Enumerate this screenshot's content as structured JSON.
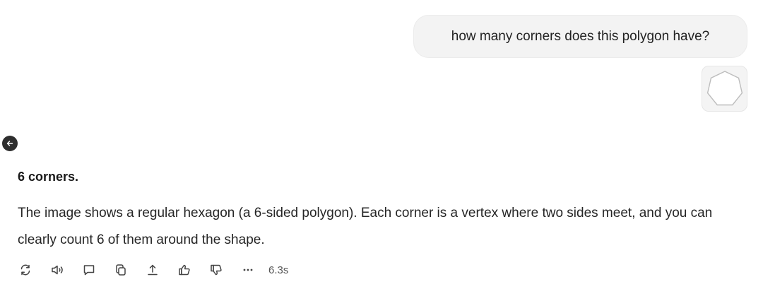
{
  "user_message": {
    "text": "how many corners does this polygon have?",
    "attachment_icon": "heptagon-image"
  },
  "answer": {
    "title": "6 corners.",
    "body": "The image shows a regular hexagon (a 6-sided polygon). Each corner is a vertex where two sides meet, and you can clearly count 6 of them around the shape."
  },
  "toolbar": {
    "icons": [
      "regenerate-icon",
      "speaker-icon",
      "comment-icon",
      "copy-icon",
      "share-icon",
      "thumbs-up-icon",
      "thumbs-down-icon",
      "more-icon"
    ],
    "timing": "6.3s"
  }
}
